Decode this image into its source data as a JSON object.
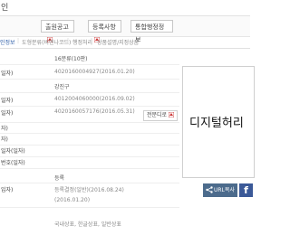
{
  "header": {
    "title": "인"
  },
  "toolbar": {
    "buttons": [
      {
        "label": "출원공고",
        "icon": "pdf-icon"
      },
      {
        "label": "등록사항",
        "icon": "pdf-icon"
      },
      {
        "label": "통합행정정보",
        "icon": ""
      }
    ]
  },
  "tabs": [
    {
      "label": "인정보"
    },
    {
      "label": "도형분류(비엔나코드)"
    },
    {
      "label": "행정처리"
    },
    {
      "label": "상품설명/지정상품"
    }
  ],
  "fields": [
    {
      "label": "",
      "value": "16분류(10판)"
    },
    {
      "label": "일자)",
      "value": "4020160004927(2016.01.20)"
    },
    {
      "label": "",
      "value": "강진구"
    },
    {
      "label": "일자)",
      "value": "4012004060000(2016.09.02)"
    },
    {
      "label": "일자)",
      "value": "4020160057176(2016.05.31)"
    },
    {
      "label": "자)",
      "value": ""
    },
    {
      "label": "자)",
      "value": ""
    },
    {
      "label": "일자(일자)",
      "value": ""
    },
    {
      "label": "번호(일자)",
      "value": ""
    },
    {
      "label": "",
      "value": "등록"
    },
    {
      "label": "입자)",
      "value": "등록결정(일반)(2016.08.24)"
    },
    {
      "label": "",
      "value": "(2016.01.20)"
    },
    {
      "label": "",
      "value": "국내상표, 한글상표, 일반상표"
    }
  ],
  "expert_button": {
    "label": "전문디로",
    "icon": "pdf-icon"
  },
  "mark_image": {
    "text": "디지털허리"
  },
  "share": {
    "label": "URL복사",
    "icon": "share-icon"
  },
  "facebook": {
    "label": "f",
    "icon": "facebook-icon"
  }
}
